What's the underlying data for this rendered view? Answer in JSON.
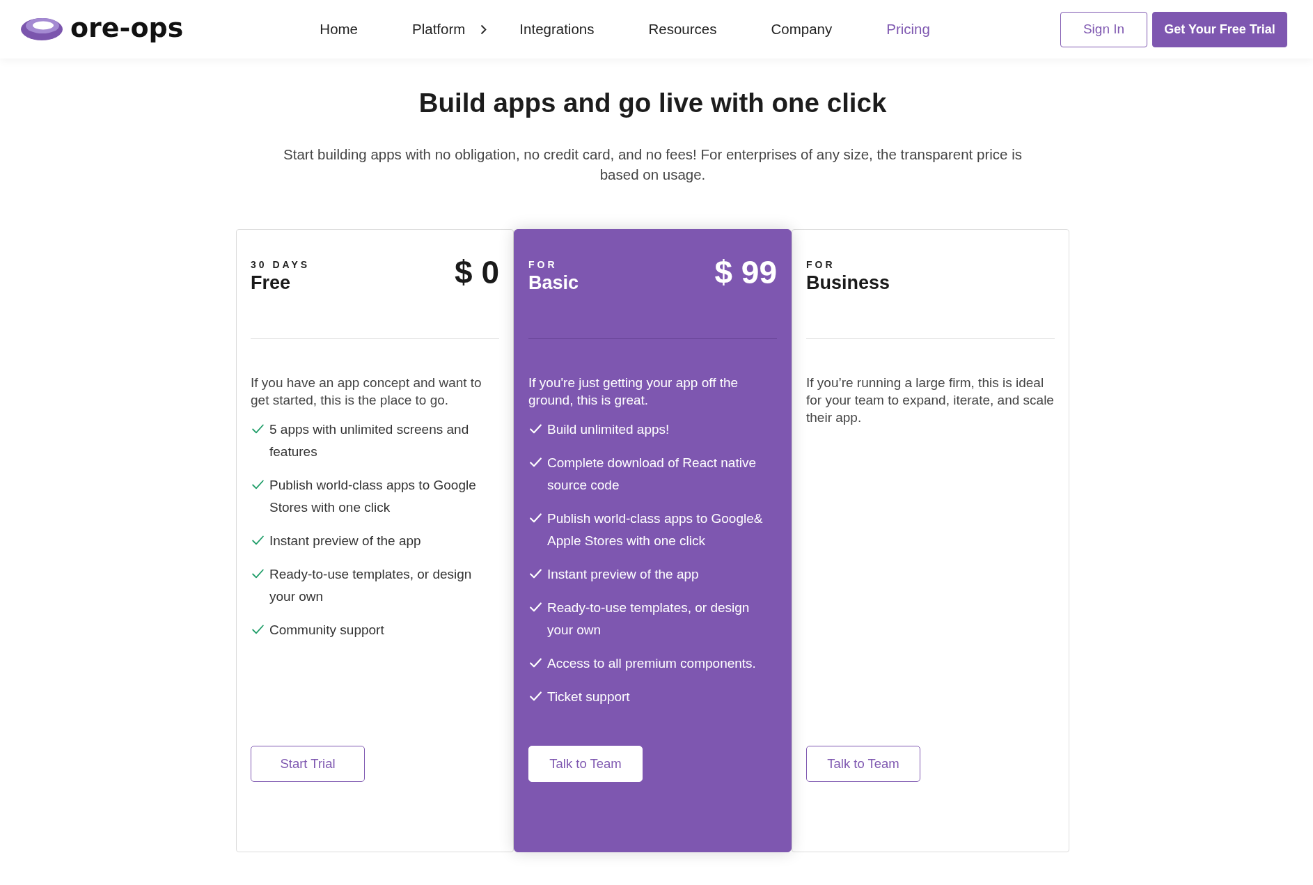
{
  "header": {
    "logo": "ore-ops",
    "nav": [
      {
        "label": "Home",
        "selected": false,
        "submenu": false
      },
      {
        "label": "Platform",
        "selected": false,
        "submenu": true
      },
      {
        "label": "Integrations",
        "selected": false,
        "submenu": false
      },
      {
        "label": "Resources",
        "selected": false,
        "submenu": false
      },
      {
        "label": "Company",
        "selected": false,
        "submenu": false
      },
      {
        "label": "Pricing",
        "selected": true,
        "submenu": false
      }
    ],
    "actions": [
      {
        "label": "Sign In",
        "kind": "outline"
      },
      {
        "label": "Get Your Free Trial",
        "kind": "solid"
      }
    ]
  },
  "hero": {
    "title": "Build apps and go live with one click",
    "subtitle": "Start building apps with no obligation, no credit card, and no fees! For enterprises of any size, the transparent price is based on usage."
  },
  "plans": [
    {
      "eyebrow": "30 DAYS",
      "name": "Free",
      "price": "$ 0",
      "featured": false,
      "description": "If you have an app concept and want to get started, this is the place to go.",
      "features": [
        "5 apps with unlimited screens and features",
        "Publish world-class apps to Google Stores with one click",
        "Instant preview of the app",
        "Ready-to-use templates, or design your own",
        "Community support"
      ],
      "button": "Start Trial"
    },
    {
      "eyebrow": "FOR",
      "name": "Basic",
      "price": "$ 99",
      "featured": true,
      "description": "If you're just getting your app off the ground, this is great.",
      "features": [
        "Build unlimited apps!",
        "Complete download of React native source code",
        "Publish world-class apps to Google& Apple Stores with one click",
        "Instant preview of the app",
        "Ready-to-use templates, or design your own",
        "Access to all premium components.",
        "Ticket support"
      ],
      "button": "Talk to Team"
    },
    {
      "eyebrow": "FOR",
      "name": "Business",
      "featured": false,
      "description": "If you’re running a large firm, this is ideal for your team to expand, iterate, and scale their app.",
      "button": "Talk to Team"
    }
  ]
}
